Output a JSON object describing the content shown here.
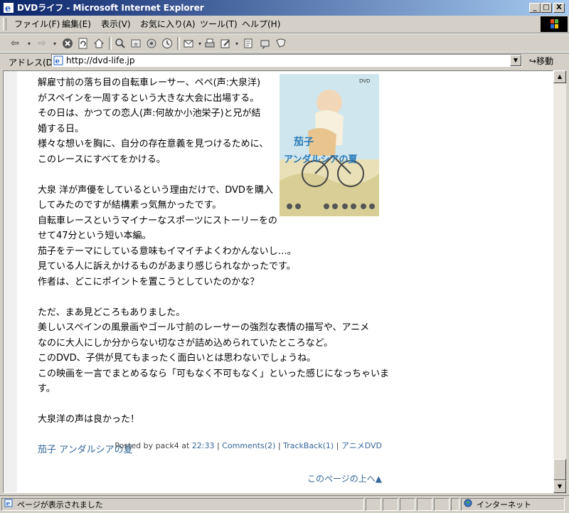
{
  "window": {
    "title": "DVDライフ - Microsoft Internet Explorer",
    "minimize": "_",
    "maximize": "□",
    "close": "X"
  },
  "menu": {
    "items": [
      "ファイル(F)",
      "編集(E)",
      "表示(V)",
      "お気に入り(A)",
      "ツール(T)",
      "ヘルプ(H)"
    ]
  },
  "address": {
    "label": "アドレス(D)",
    "url": "http://dvd-life.jp",
    "go_label": "移動"
  },
  "article": {
    "paragraphs": [
      [
        "解雇寸前の落ち目の自転車レーサー、ペペ(声:大泉洋)",
        "がスペインを一周するという大きな大会に出場する。",
        "その日は、かつての恋人(声:何故か小池栄子)と兄が結",
        "婚する日。",
        "様々な想いを胸に、自分の存在意義を見つけるために、",
        "このレースにすべてをかける。"
      ],
      [
        "大泉 洋が声優をしているという理由だけで、DVDを購入",
        "してみたのですが結構素っ気無かったです。",
        "自転車レースというマイナーなスポーツにストーリーをの",
        "せて47分という短い本編。",
        "茄子をテーマにしている意味もイマイチよくわかんないし…。",
        "見ている人に訴えかけるものがあまり感じられなかったです。",
        "作者は、どこにポイントを置こうとしていたのかな？"
      ],
      [
        "ただ、まあ見どころもありました。",
        "美しいスペインの風景画やゴール寸前のレーサーの強烈な表情の描写や、アニメ",
        "なのに大人にしか分からない切なさが詰め込められていたところなど。",
        "このDVD、子供が見てもまったく面白いとは思わないでしょうね。",
        "この映画を一言でまとめるなら「可もなく不可もなく」といった感じになっちゃいます。"
      ],
      [
        "大泉洋の声は良かった！"
      ]
    ],
    "section_link": "茄子 アンダルシアの夏",
    "dvd_cover": {
      "title_line1": "茄子",
      "title_line2": "アンダルシアの夏",
      "badge": "DVD"
    },
    "meta": {
      "posted_by": "Posted by pack4 at",
      "time": "22:33",
      "comments": "Comments(2)",
      "trackback": "TrackBack(1)",
      "category": "アニメDVD",
      "sep": "|"
    },
    "page_top": "このページの上へ▲"
  },
  "status": {
    "text": "ページが表示されました",
    "zone": "インターネット"
  },
  "colors": {
    "titlebar_start": "#0a246a",
    "titlebar_end": "#a6caf0",
    "link": "#336699",
    "chrome": "#d4d0c8"
  }
}
